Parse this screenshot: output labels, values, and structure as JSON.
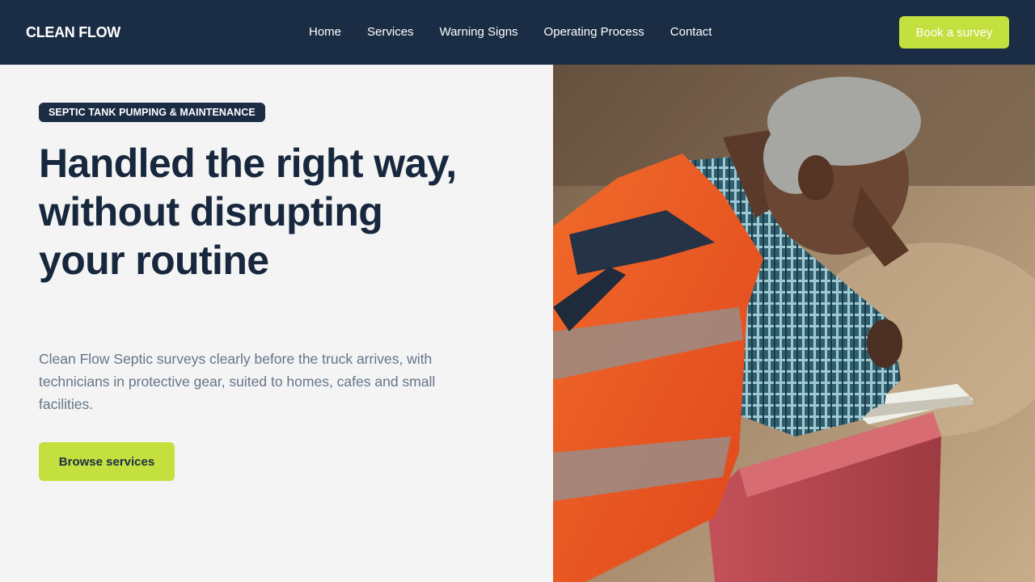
{
  "header": {
    "brand": "CLEAN FLOW",
    "nav": [
      "Home",
      "Services",
      "Warning Signs",
      "Operating Process",
      "Contact"
    ],
    "cta": "Book a survey"
  },
  "hero": {
    "eyebrow": "SEPTIC TANK PUMPING & MAINTENANCE",
    "headline": "Handled the right way, without disrupting your routine",
    "subtext": "Clean Flow Septic surveys clearly before the truck arrives, with technicians in protective gear, suited to homes, cafes and small facilities.",
    "cta": "Browse services"
  },
  "colors": {
    "navy": "#1b2d44",
    "lime": "#c3e03f",
    "page_bg": "#f3f4f3",
    "body_text": "#66758a"
  },
  "icons": {
    "hero_photo": "worker-in-safety-vest-photo"
  }
}
